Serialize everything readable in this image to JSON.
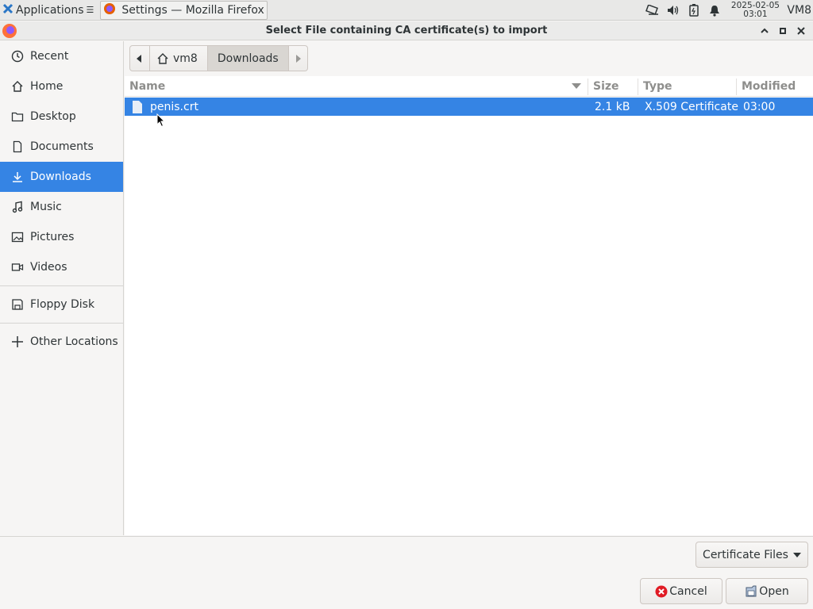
{
  "panel": {
    "apps_label": "Applications",
    "task_label": "Settings — Mozilla Firefox",
    "clock_date": "2025-02-05",
    "clock_time": "03:01",
    "vm_label": "VM8"
  },
  "dialog": {
    "title": "Select File containing CA certificate(s) to import"
  },
  "sidebar": {
    "items": [
      {
        "label": "Recent",
        "icon": "clock-icon"
      },
      {
        "label": "Home",
        "icon": "home-icon"
      },
      {
        "label": "Desktop",
        "icon": "folder-icon"
      },
      {
        "label": "Documents",
        "icon": "document-icon"
      },
      {
        "label": "Downloads",
        "icon": "download-icon"
      },
      {
        "label": "Music",
        "icon": "music-icon"
      },
      {
        "label": "Pictures",
        "icon": "picture-icon"
      },
      {
        "label": "Videos",
        "icon": "video-icon"
      }
    ],
    "devices": [
      {
        "label": "Floppy Disk",
        "icon": "floppy-icon"
      }
    ],
    "other": {
      "label": "Other Locations",
      "icon": "plus-icon"
    }
  },
  "pathbar": {
    "home_label": "vm8",
    "current_label": "Downloads"
  },
  "filelist": {
    "columns": {
      "name": "Name",
      "size": "Size",
      "type": "Type",
      "modified": "Modified"
    },
    "rows": [
      {
        "name": "penis.crt",
        "size": "2.1 kB",
        "type": "X.509 Certificate",
        "modified": "03:00",
        "selected": true
      }
    ]
  },
  "footer": {
    "filter_label": "Certificate Files",
    "cancel_label": "Cancel",
    "open_label": "Open"
  },
  "colors": {
    "accent": "#3584e4"
  }
}
